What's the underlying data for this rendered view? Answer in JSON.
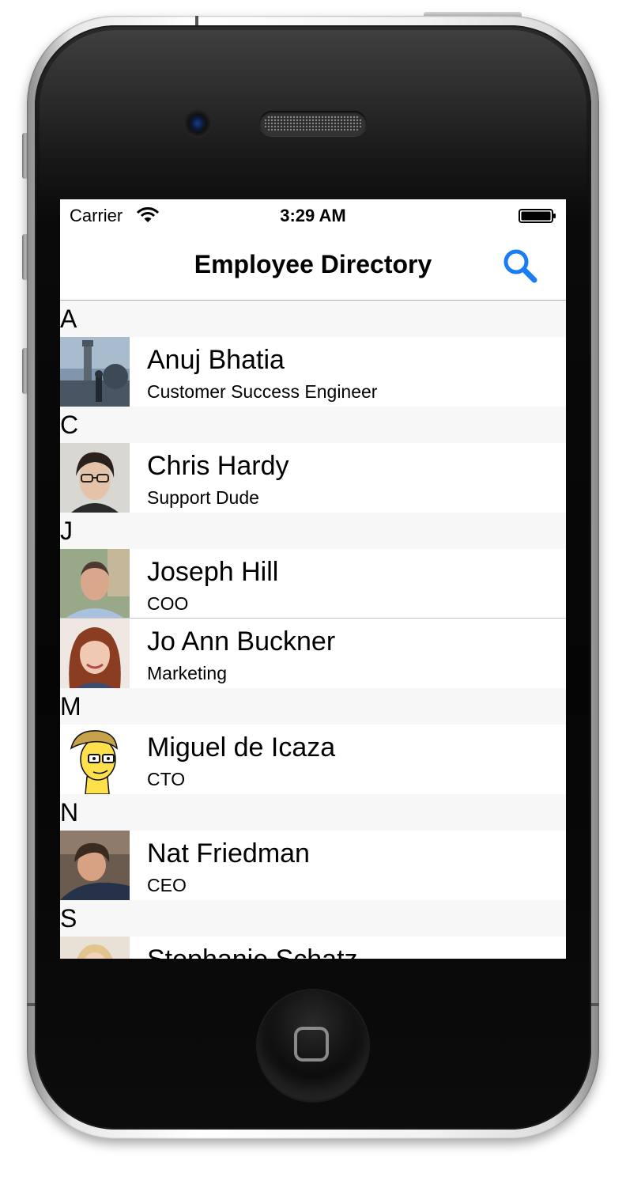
{
  "status_bar": {
    "carrier": "Carrier",
    "time": "3:29 AM"
  },
  "nav_bar": {
    "title": "Employee Directory",
    "search_icon": "magnifying-glass-icon"
  },
  "colors": {
    "accent": "#1a7ef2",
    "section_header_bg": "#f7f7f7",
    "divider": "#c8c7cc"
  },
  "sections": [
    {
      "letter": "A",
      "employees": [
        {
          "name": "Anuj Bhatia",
          "title": "Customer Success Engineer"
        }
      ]
    },
    {
      "letter": "C",
      "employees": [
        {
          "name": "Chris Hardy",
          "title": "Support Dude"
        }
      ]
    },
    {
      "letter": "J",
      "employees": [
        {
          "name": "Joseph Hill",
          "title": "COO"
        },
        {
          "name": "Jo Ann Buckner",
          "title": "Marketing"
        }
      ]
    },
    {
      "letter": "M",
      "employees": [
        {
          "name": "Miguel de Icaza",
          "title": "CTO"
        }
      ]
    },
    {
      "letter": "N",
      "employees": [
        {
          "name": "Nat Friedman",
          "title": "CEO"
        }
      ]
    },
    {
      "letter": "S",
      "employees": [
        {
          "name": "Stephanie Schatz",
          "title": ""
        }
      ]
    }
  ]
}
